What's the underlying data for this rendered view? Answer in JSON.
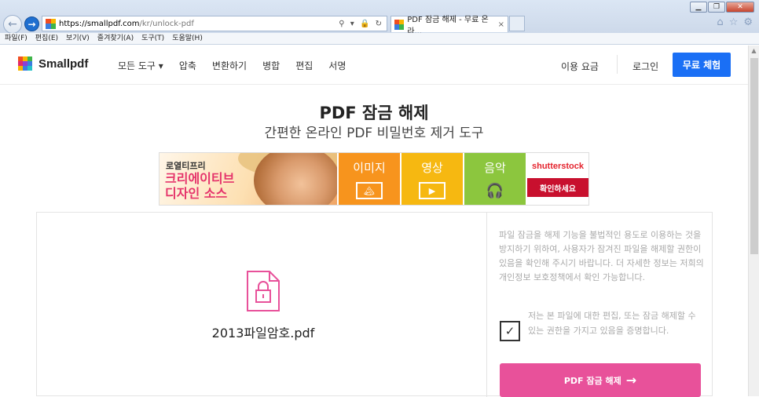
{
  "browser": {
    "url_host": "https://smallpdf.com",
    "url_path": "/kr/unlock-pdf",
    "address_tools": "⚲ ▾ 🔒 ↻",
    "tab_title": "PDF 잠금 해제 - 무료 온라...",
    "tab_close": "×",
    "menu": [
      "파일(F)",
      "편집(E)",
      "보기(V)",
      "즐겨찾기(A)",
      "도구(T)",
      "도움말(H)"
    ]
  },
  "site": {
    "logo_text": "Smallpdf",
    "nav": [
      "모든 도구 ▾",
      "압축",
      "변환하기",
      "병합",
      "편집",
      "서명"
    ],
    "pricing": "이용 요금",
    "login": "로그인",
    "trial": "무료 체험"
  },
  "hero": {
    "title": "PDF 잠금 해제",
    "subtitle": "간편한 온라인 PDF 비밀번호 제거 도구"
  },
  "ad": {
    "small_text": "로열티프리",
    "big_line1": "크리에이티브",
    "big_line2": "디자인 소스",
    "tiles": [
      {
        "label": "이미지",
        "icon": "🏔",
        "color": "#f7941d"
      },
      {
        "label": "영상",
        "icon": "▶",
        "color": "#f6b811"
      },
      {
        "label": "음악",
        "icon": "🎧",
        "color": "#8cc63e"
      }
    ],
    "brand": "shutterstock",
    "cta": "확인하세요"
  },
  "tool": {
    "filename": "2013파일암호.pdf",
    "notice": "파일 잠금을 해제 기능을 불법적인 용도로 이용하는 것을 방지하기 위하여, 사용자가 잠겨진 파일을 해제할 권한이 있음을 확인해 주시기 바랍니다. 더 자세한 정보는 저희의 개인정보 보호정책에서 확인 가능합니다.",
    "checkbox_mark": "✓",
    "checkbox_label": "저는 본 파일에 대한 편집, 또는 잠금 해제할 수 있는 권한을 가지고 있음을 증명합니다.",
    "button": "PDF 잠금 해제",
    "button_arrow": "→",
    "accent": "#e8519a"
  }
}
